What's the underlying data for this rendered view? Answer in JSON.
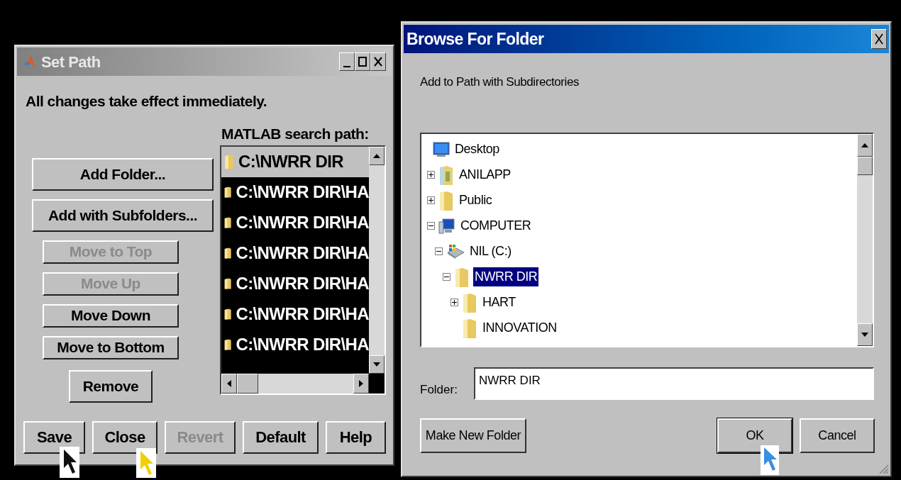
{
  "set_path": {
    "title": "Set Path",
    "message": "All changes take effect immediately.",
    "path_label": "MATLAB search path:",
    "path_list": [
      {
        "text": "C:\\NWRR DIR",
        "selected": true
      },
      {
        "text": "C:\\NWRR DIR\\HA",
        "selected": false
      },
      {
        "text": "C:\\NWRR DIR\\HA",
        "selected": false
      },
      {
        "text": "C:\\NWRR DIR\\HA",
        "selected": false
      },
      {
        "text": "C:\\NWRR DIR\\HA",
        "selected": false
      },
      {
        "text": "C:\\NWRR DIR\\HA",
        "selected": false
      },
      {
        "text": "C:\\NWRR DIR\\HA",
        "selected": false
      }
    ],
    "side_buttons": [
      {
        "label": "Add Folder...",
        "kind": "wide",
        "disabled": false
      },
      {
        "label": "Add with Subfolders...",
        "kind": "wide",
        "disabled": false
      },
      {
        "label": "Move to Top",
        "kind": "medium",
        "disabled": true
      },
      {
        "label": "Move Up",
        "kind": "medium",
        "disabled": true
      },
      {
        "label": "Move Down",
        "kind": "medium",
        "disabled": false
      },
      {
        "label": "Move to Bottom",
        "kind": "medium",
        "disabled": false
      },
      {
        "label": "Remove",
        "kind": "narrow",
        "disabled": false
      }
    ],
    "bottom_buttons": [
      {
        "label": "Save",
        "disabled": false
      },
      {
        "label": "Close",
        "disabled": false
      },
      {
        "label": "Revert",
        "disabled": true
      },
      {
        "label": "Default",
        "disabled": false
      },
      {
        "label": "Help",
        "disabled": false
      }
    ]
  },
  "browse": {
    "title": "Browse For Folder",
    "instruction": "Add to Path with Subdirectories",
    "tree": [
      {
        "label": "Desktop",
        "kind": "desktop",
        "selected": false,
        "children": [
          {
            "label": "ANILAPP",
            "kind": "user-folder",
            "selected": false,
            "expanded": false
          },
          {
            "label": "Public",
            "kind": "folder",
            "selected": false,
            "expanded": false
          },
          {
            "label": "COMPUTER",
            "kind": "computer",
            "selected": false,
            "expanded": true,
            "children": [
              {
                "label": "NIL (C:)",
                "kind": "drive",
                "selected": false,
                "expanded": true,
                "children": [
                  {
                    "label": "NWRR DIR",
                    "kind": "folder",
                    "selected": true,
                    "expanded": true,
                    "children": [
                      {
                        "label": "HART",
                        "kind": "folder",
                        "selected": false,
                        "expanded": false
                      },
                      {
                        "label": "INNOVATION",
                        "kind": "folder",
                        "selected": false
                      }
                    ]
                  }
                ]
              }
            ]
          }
        ]
      }
    ],
    "folder_label": "Folder:",
    "folder_value": "NWRR DIR",
    "buttons": [
      {
        "label": "Make New Folder",
        "kind": "left"
      },
      {
        "label": "OK",
        "kind": "default"
      },
      {
        "label": "Cancel",
        "kind": "plain"
      }
    ]
  }
}
